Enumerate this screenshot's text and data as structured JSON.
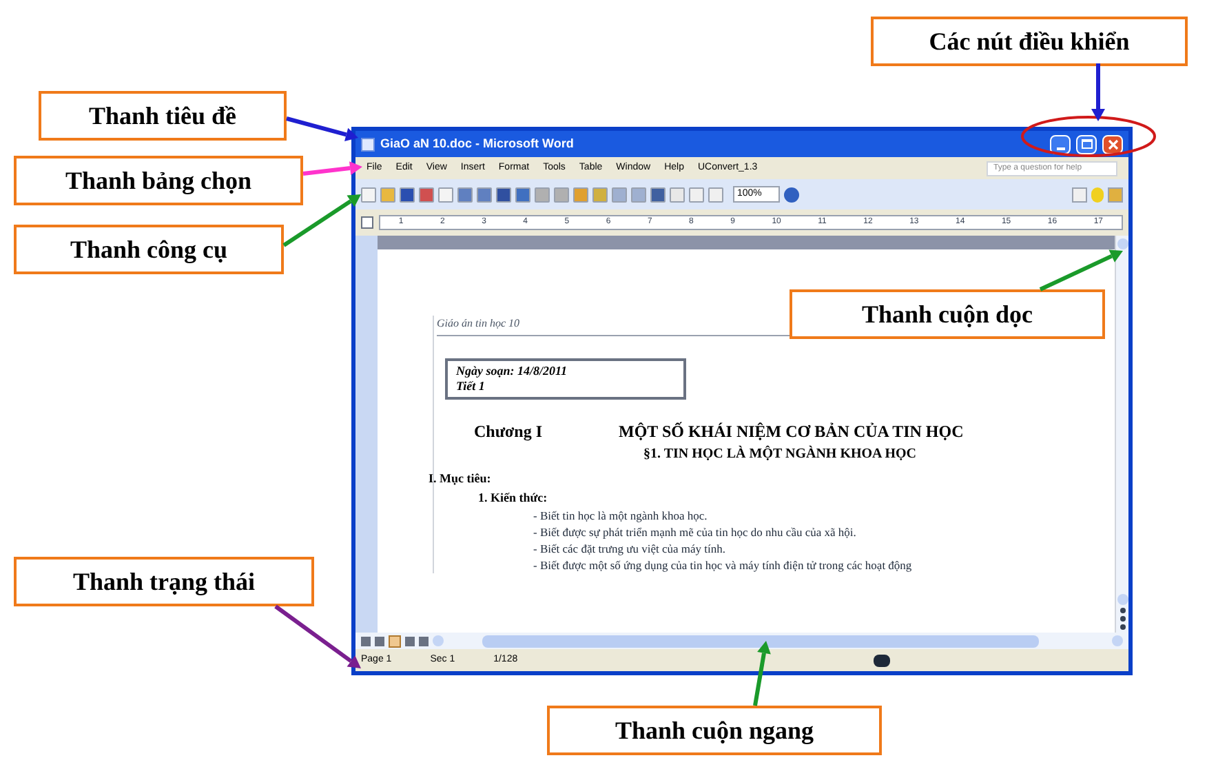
{
  "callouts": [
    {
      "label": "Thanh tiêu đề",
      "color": "#1f1fd0"
    },
    {
      "label": "Thanh bảng chọn",
      "color": "#ff33cc"
    },
    {
      "label": "Thanh công cụ",
      "color": "#1a9a2a"
    },
    {
      "label": "Các nút điều khiển",
      "color": "#1f1fd0"
    },
    {
      "label": "Thanh cuộn dọc",
      "color": "#1a9a2a"
    },
    {
      "label": "Thanh trạng thái",
      "color": "#7a1f8f"
    },
    {
      "label": "Thanh cuộn ngang",
      "color": "#1a9a2a"
    }
  ],
  "window": {
    "title": "GiaO aN 10.doc - Microsoft Word",
    "menu": [
      "File",
      "Edit",
      "View",
      "Insert",
      "Format",
      "Tools",
      "Table",
      "Window",
      "Help",
      "UConvert_1.3"
    ],
    "help_placeholder": "Type a question for help",
    "zoom": "100%",
    "ruler_numbers": [
      "1",
      "2",
      "3",
      "4",
      "5",
      "6",
      "7",
      "8",
      "9",
      "10",
      "11",
      "12",
      "13",
      "14",
      "15",
      "16",
      "17"
    ],
    "document": {
      "header": "Giáo án tin học 10",
      "date_box": [
        "Ngày soạn: 14/8/2011",
        "Tiết 1"
      ],
      "chapter": "Chương I",
      "chapter_title": "MỘT SỐ KHÁI NIỆM CƠ BẢN CỦA TIN HỌC",
      "section_title": "§1. TIN HỌC LÀ MỘT NGÀNH KHOA HỌC",
      "heading": "I. Mục tiêu:",
      "subheading": "1. Kiến thức:",
      "bullets": [
        "- Biết tin học là một ngành khoa học.",
        "- Biết được sự phát triển mạnh mẽ của tin học do nhu cầu của xã hội.",
        "- Biết các đặt trưng ưu việt của máy tính.",
        "- Biết được một số ứng dụng của tin học và máy tính điện tử trong các hoạt động"
      ]
    },
    "status": [
      "Page 1",
      "Sec 1",
      "1/128"
    ]
  }
}
